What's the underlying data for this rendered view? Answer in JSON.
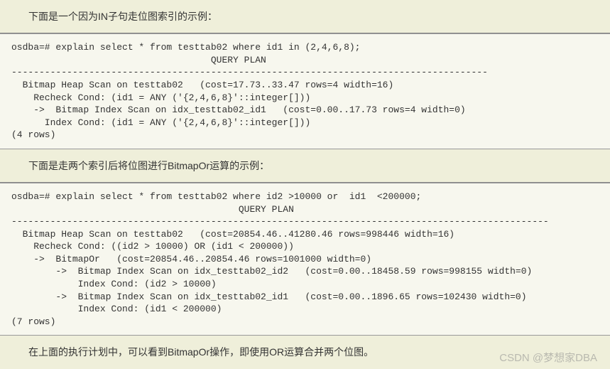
{
  "section1": {
    "intro": "下面是一个因为IN子句走位图索引的示例："
  },
  "code1": "osdba=# explain select * from testtab02 where id1 in (2,4,6,8);\n                                    QUERY PLAN\n--------------------------------------------------------------------------------------\n  Bitmap Heap Scan on testtab02   (cost=17.73..33.47 rows=4 width=16)\n    Recheck Cond: (id1 = ANY ('{2,4,6,8}'::integer[]))\n    ->  Bitmap Index Scan on idx_testtab02_id1   (cost=0.00..17.73 rows=4 width=0)\n      Index Cond: (id1 = ANY ('{2,4,6,8}'::integer[]))\n(4 rows)",
  "section2": {
    "intro": "下面是走两个索引后将位图进行BitmapOr运算的示例："
  },
  "code2": "osdba=# explain select * from testtab02 where id2 >10000 or  id1  <200000;\n                                         QUERY PLAN\n-------------------------------------------------------------------------------------------------\n  Bitmap Heap Scan on testtab02   (cost=20854.46..41280.46 rows=998446 width=16)\n    Recheck Cond: ((id2 > 10000) OR (id1 < 200000))\n    ->  BitmapOr   (cost=20854.46..20854.46 rows=1001000 width=0)\n        ->  Bitmap Index Scan on idx_testtab02_id2   (cost=0.00..18458.59 rows=998155 width=0)\n            Index Cond: (id2 > 10000)\n        ->  Bitmap Index Scan on idx_testtab02_id1   (cost=0.00..1896.65 rows=102430 width=0)\n            Index Cond: (id1 < 200000)\n(7 rows)",
  "section3": {
    "text": "在上面的执行计划中，可以看到BitmapOr操作，即使用OR运算合并两个位图。"
  },
  "watermark": "CSDN @梦想家DBA"
}
